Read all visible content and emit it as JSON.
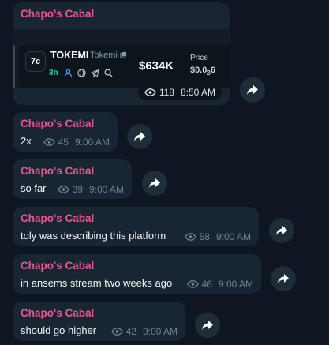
{
  "messages": [
    {
      "sender": "Chapo's Cabal",
      "views": "118",
      "time": "8:50 AM",
      "card": {
        "logo": "7c",
        "name": "TOKEMI",
        "subname": "Tokemi",
        "age": "3h",
        "market_cap": "$634K",
        "price_label": "Price",
        "price_prefix": "$0.0",
        "price_sub": "3",
        "price_suffix": "6"
      }
    },
    {
      "sender": "Chapo's Cabal",
      "text": "2x",
      "views": "45",
      "time": "9:00 AM"
    },
    {
      "sender": "Chapo's Cabal",
      "text": "so far",
      "views": "39",
      "time": "9:00 AM"
    },
    {
      "sender": "Chapo's Cabal",
      "text": "toly was describing this platform",
      "views": "58",
      "time": "9:00 AM"
    },
    {
      "sender": "Chapo's Cabal",
      "text": "in ansems stream two weeks ago",
      "views": "46",
      "time": "9:00 AM"
    },
    {
      "sender": "Chapo's Cabal",
      "text": "should go higher",
      "views": "42",
      "time": "9:00 AM"
    }
  ],
  "colors": {
    "background": "#0e1621",
    "bubble": "#182533",
    "sender": "#e8578d",
    "meta": "#6d8196",
    "accent_green": "#20d2a6",
    "accent_blue": "#4aa3ff"
  },
  "icons": [
    "eye-icon",
    "forward-icon",
    "copy-icon",
    "person-icon",
    "globe-icon",
    "telegram-icon",
    "search-icon"
  ]
}
